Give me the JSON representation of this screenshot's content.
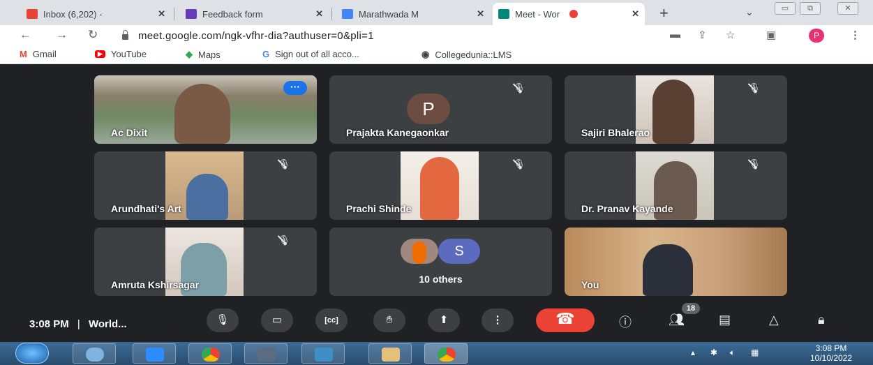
{
  "browser": {
    "tabs": [
      {
        "title": "Inbox (6,202) - ",
        "icon": "gmail-icon",
        "color": "#ea4335"
      },
      {
        "title": "Feedback form",
        "icon": "forms-icon",
        "color": "#673ab7"
      },
      {
        "title": "Marathwada M",
        "icon": "calendar-icon",
        "color": "#4285f4"
      },
      {
        "title": "Meet - Wor",
        "icon": "meet-icon",
        "color": "#00897b"
      }
    ],
    "tab_close": "✕",
    "new_tab": "+",
    "url": "meet.google.com/ngk-vfhr-dia?authuser=0&pli=1",
    "profile_initial": "P",
    "bookmarks": [
      {
        "label": "Gmail",
        "icon": "gmail-icon"
      },
      {
        "label": "YouTube",
        "icon": "youtube-icon"
      },
      {
        "label": "Maps",
        "icon": "maps-icon"
      },
      {
        "label": "Sign out of all acco...",
        "icon": "google-icon"
      },
      {
        "label": "Collegedunia::LMS",
        "icon": "globe-icon"
      }
    ]
  },
  "meet": {
    "participants": [
      {
        "name": "Ac Dixit",
        "speaking": true
      },
      {
        "name": "Prajakta Kanegaonkar",
        "avatar": "P"
      },
      {
        "name": "Sajiri Bhalerao"
      },
      {
        "name": "Arundhati's Art"
      },
      {
        "name": "Prachi Shinde"
      },
      {
        "name": "Dr. Pranav Kayande"
      },
      {
        "name": "Amruta Kshirsagar"
      },
      {
        "name": "You"
      }
    ],
    "others": {
      "avatar": "S",
      "label": "10 others"
    },
    "time": "3:08 PM",
    "separator": "|",
    "meeting_name": "World...",
    "people_count": "18"
  },
  "taskbar": {
    "time": "3:08 PM",
    "date": "10/10/2022"
  },
  "colors": {
    "stage": "#202124",
    "tile": "#3c4043",
    "end_call": "#ea4335",
    "highlight": "#8ab4f8"
  }
}
